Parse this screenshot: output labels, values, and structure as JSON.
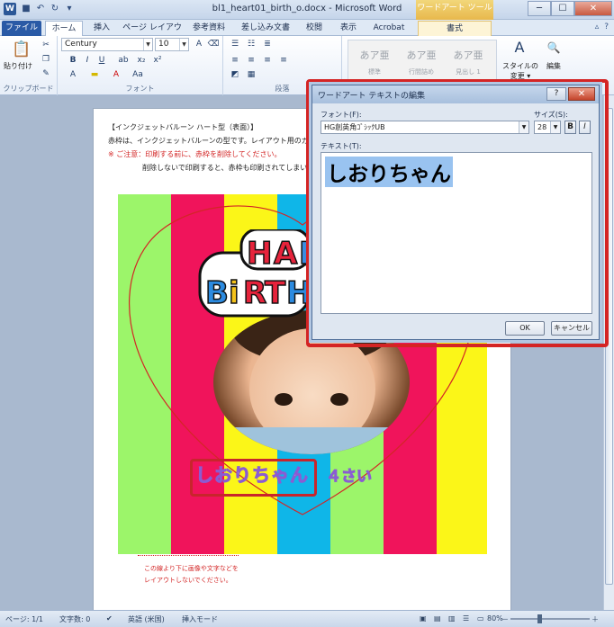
{
  "window": {
    "title": "bl1_heart01_birth_o.docx - Microsoft Word",
    "app_icon": "W",
    "contextual_tab_group": "ワードアート ツール",
    "minimize": "─",
    "maximize": "☐",
    "close": "✕"
  },
  "qat": {
    "save": "save-icon",
    "undo": "undo-icon",
    "redo": "redo-icon"
  },
  "tabs": [
    "ファイル",
    "ホーム",
    "挿入",
    "ページ レイアウト",
    "参考資料",
    "差し込み文書",
    "校閲",
    "表示",
    "Acrobat",
    "書式"
  ],
  "ribbon": {
    "paste_label": "貼り付け",
    "clipboard_group": "クリップボード",
    "font_name": "Century",
    "font_size": "10",
    "font_group": "フォント",
    "paragraph_group": "段落",
    "styles": [
      {
        "sample": "あア亜",
        "name": "標準"
      },
      {
        "sample": "あア亜",
        "name": "行間詰め"
      },
      {
        "sample": "あア亜",
        "name": "見出し 1"
      }
    ],
    "style_change_label": "スタイルの\n変更 ▾",
    "style_change_line1": "スタイルの",
    "style_change_line2": "変更 ▾",
    "edit_label": "編集"
  },
  "document": {
    "line1": "【インクジェットバルーン ハート型（表面）】",
    "line2": "赤枠は、インクジェットバルーンの型です。レイアウト用のガ",
    "line3": "※ ご注意：印刷する前に、赤枠を削除してください。",
    "line4": "削除しないで印刷すると、赤枠も印刷されてしまい",
    "wordart_text": "しおりちゃん",
    "age_text": "４さい",
    "birthday_letters": [
      "H",
      "A",
      "P",
      "B",
      "i",
      "R",
      "T",
      "H"
    ],
    "note1": "この線より下に画像や文字などを",
    "note2": "レイアウトしないでください。",
    "stripe_colors": [
      "#9cf56a",
      "#f0145b",
      "#fbf618",
      "#0fb6e8",
      "#9cf56a",
      "#f0145b",
      "#fbf618"
    ]
  },
  "dialog": {
    "title": "ワードアート テキストの編集",
    "help": "?",
    "close": "✕",
    "font_label": "フォント(F):",
    "font_value": "HG創英角ｺﾞｼｯｸUB",
    "size_label": "サイズ(S):",
    "size_value": "28",
    "bold": "B",
    "italic": "I",
    "text_label": "テキスト(T):",
    "text_value": "しおりちゃん",
    "ok": "OK",
    "cancel": "キャンセル"
  },
  "status": {
    "page": "ページ: 1/1",
    "wordcount": "文字数: 0",
    "language": "英語 (米国)",
    "insert_mode": "挿入モード",
    "zoom": "80%",
    "zoom_minus": "－",
    "zoom_plus": "＋"
  }
}
